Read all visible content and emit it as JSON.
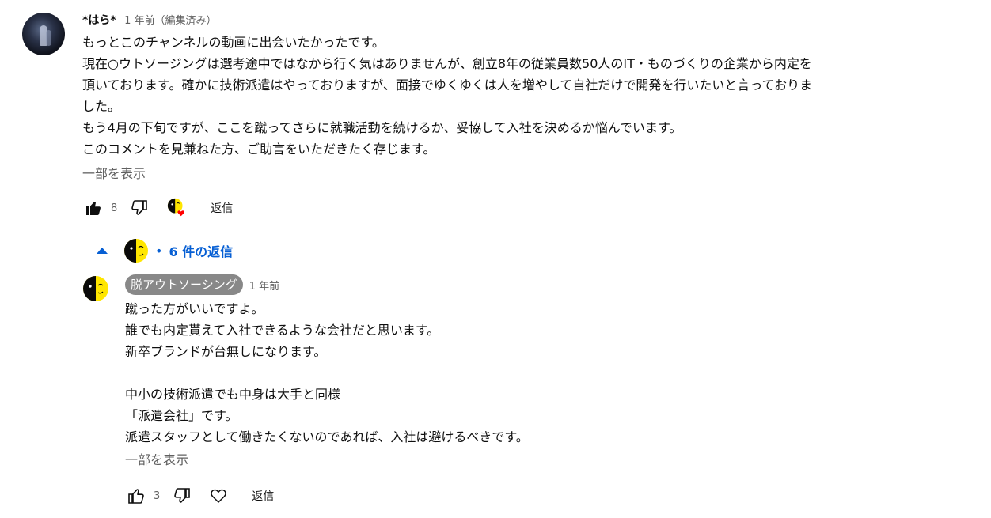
{
  "main_comment": {
    "author": "*はら*",
    "time": "1 年前（編集済み）",
    "text_lines": [
      "もっとこのチャンネルの動画に出会いたかったです。",
      "現在○ウトソージングは選考途中ではなから行く気はありませんが、創立8年の従業員数50人のIT・ものづくりの企業から内定を",
      "頂いております。確かに技術派遣はやっておりますが、面接でゆくゆくは人を増やして自社だけで開発を行いたいと言っておりま",
      "した。",
      "もう4月の下旬ですが、ここを蹴ってさらに就職活動を続けるか、妥協して入社を決めるか悩んでいます。",
      "このコメントを見兼ねた方、ご助言をいただきたく存じます。"
    ],
    "show_more": "一部を表示",
    "like_count": "8",
    "reply_label": "返信"
  },
  "replies_toggle": {
    "dot": "•",
    "label": "6 件の返信"
  },
  "reply": {
    "author": "脱アウトソーシング",
    "time": "1 年前",
    "text_lines": [
      "蹴った方がいいですよ。",
      "誰でも内定貰えて入社できるような会社だと思います。",
      "新卒ブランドが台無しになります。",
      "",
      "中小の技術派遣でも中身は大手と同様",
      "「派遣会社」です。",
      "派遣スタッフとして働きたくないのであれば、入社は避けるべきです。"
    ],
    "show_more": "一部を表示",
    "like_count": "3",
    "reply_label": "返信"
  },
  "icons": {
    "like": "thumbs-up-icon",
    "dislike": "thumbs-down-icon",
    "heart": "heart-icon",
    "creator_heart": "creator-heart-badge-icon",
    "caret": "caret-up-icon"
  },
  "colors": {
    "link_blue": "#065fd4",
    "secondary_text": "#606060",
    "heart_red": "#ff0000",
    "chip_gray": "#888888"
  }
}
